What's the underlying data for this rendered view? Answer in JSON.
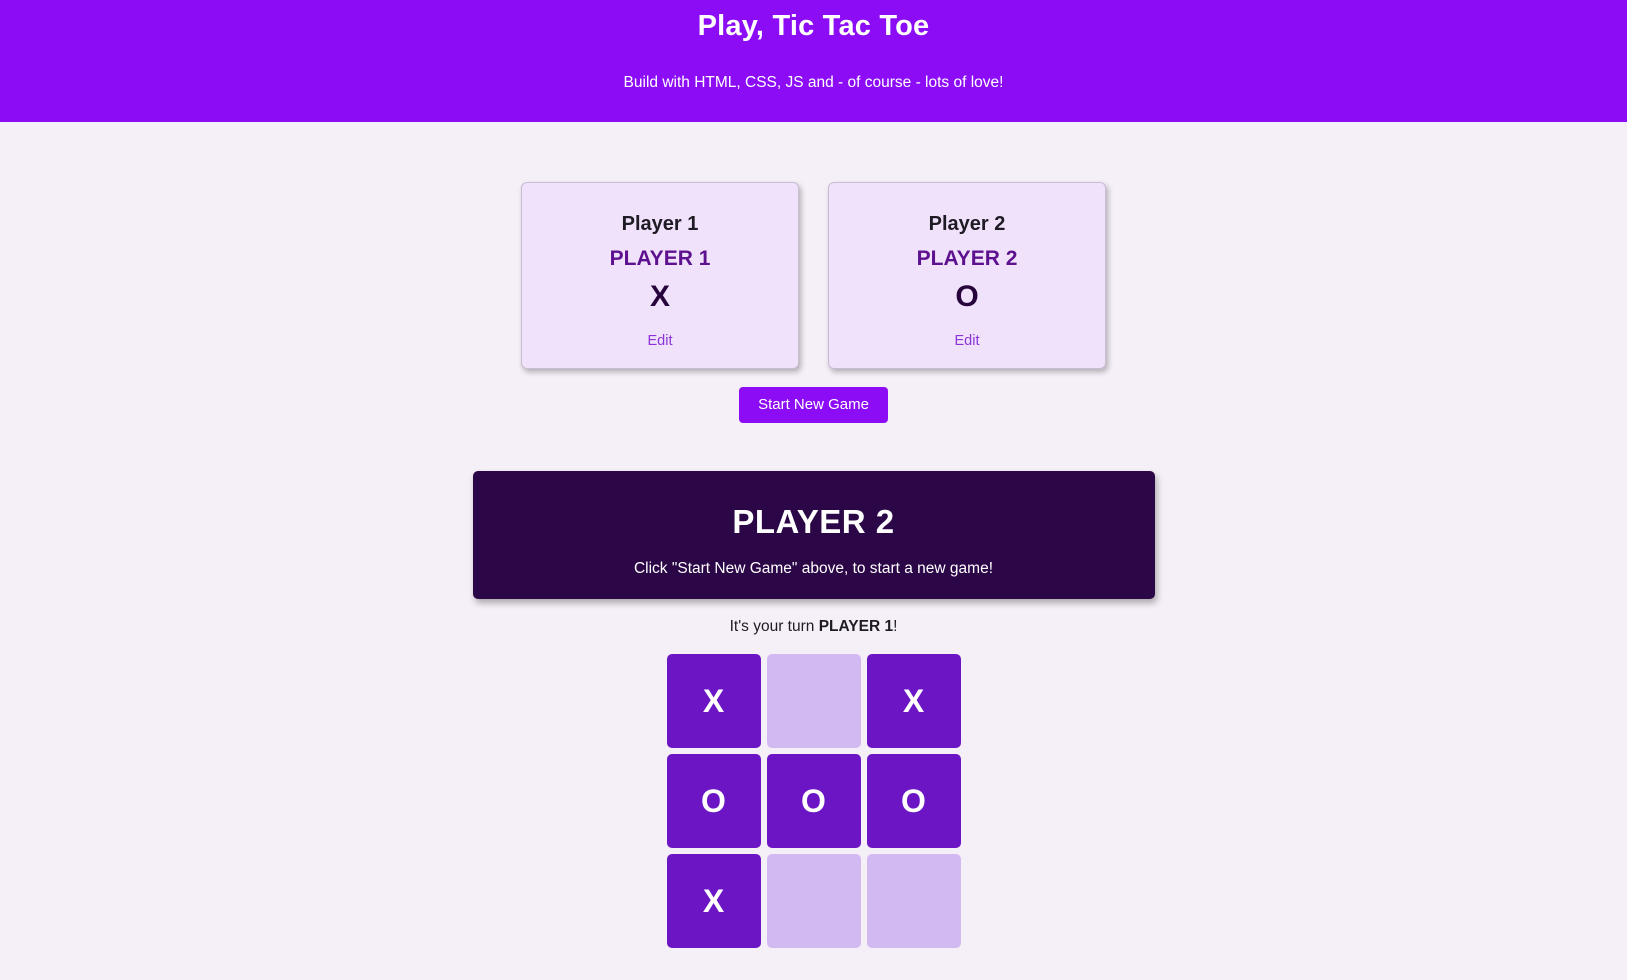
{
  "header": {
    "title": "Play, Tic Tac Toe",
    "subtitle": "Build with HTML, CSS, JS and - of course - lots of love!",
    "background_color": "#8b0cf5"
  },
  "players": [
    {
      "slot_label": "Player 1",
      "name": "PLAYER 1",
      "symbol": "X",
      "edit_label": "Edit"
    },
    {
      "slot_label": "Player 2",
      "name": "PLAYER 2",
      "symbol": "O",
      "edit_label": "Edit"
    }
  ],
  "controls": {
    "start_new_game_label": "Start New Game"
  },
  "banner": {
    "active_player": "PLAYER 2",
    "hint": "Click \"Start New Game\" above, to start a new game!",
    "background_color": "#2c0747"
  },
  "turn": {
    "prefix": "It's your turn ",
    "player": "PLAYER 1",
    "suffix": "!"
  },
  "board": {
    "filled_color": "#6b15c4",
    "empty_color": "#d3b9f1",
    "cells": [
      {
        "symbol": "X",
        "state": "filled"
      },
      {
        "symbol": "",
        "state": "empty"
      },
      {
        "symbol": "X",
        "state": "filled"
      },
      {
        "symbol": "O",
        "state": "filled"
      },
      {
        "symbol": "O",
        "state": "filled"
      },
      {
        "symbol": "O",
        "state": "filled"
      },
      {
        "symbol": "X",
        "state": "filled"
      },
      {
        "symbol": "",
        "state": "empty"
      },
      {
        "symbol": "",
        "state": "empty"
      }
    ]
  }
}
